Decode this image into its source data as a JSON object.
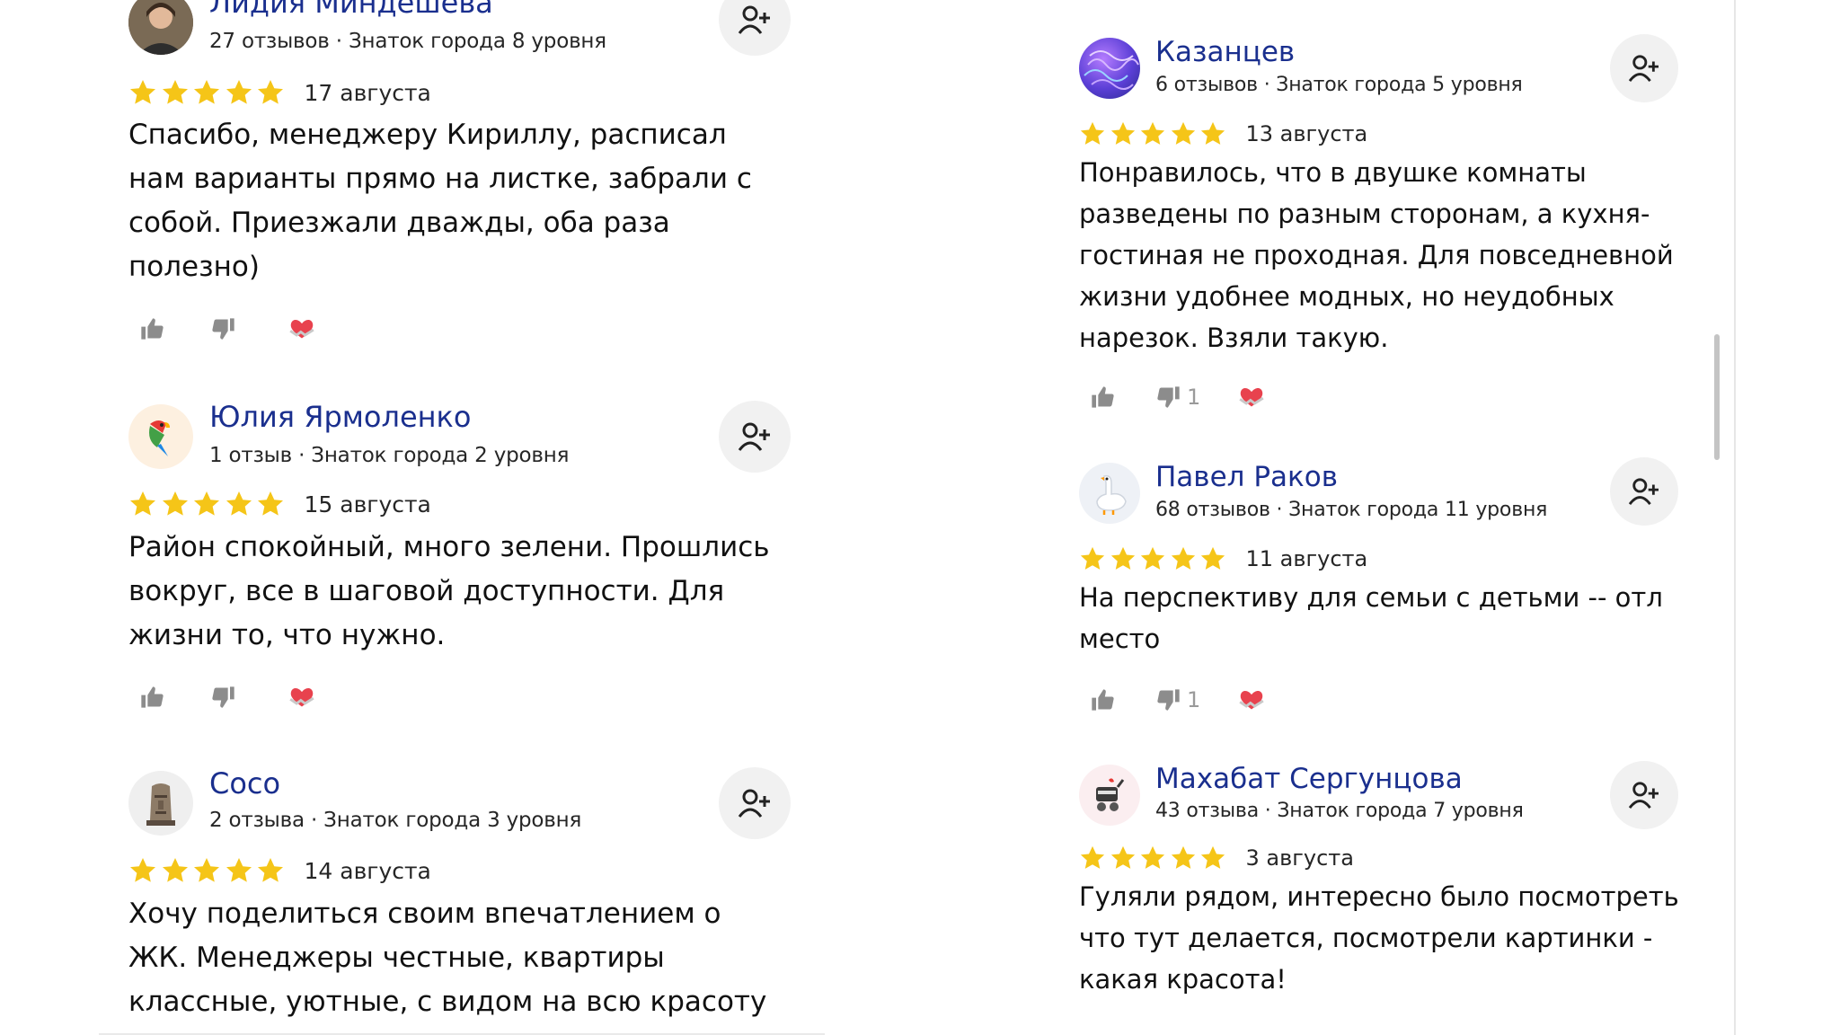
{
  "colors": {
    "author_link": "#1a2f8e",
    "star": "#f5c518",
    "action_gray": "#8c8c8c",
    "subscribe_bg": "#f1f1f1"
  },
  "left_column": {
    "reviews": [
      {
        "author": "Лидия Миндешева",
        "meta": "27 отзывов · Знаток города 8 уровня",
        "rating": 5,
        "date": "17 августа",
        "text": "Спасибо, менеджеру Кириллу, расписал\nнам варианты прямо на листке, забрали с\nсобой. Приезжали дважды, оба раза\nполезно)",
        "avatar_icon": "person-photo-avatar"
      },
      {
        "author": "Юлия Ярмоленко",
        "meta": "1 отзыв · Знаток города 2 уровня",
        "rating": 5,
        "date": "15 августа",
        "text": "Район спокойный, много зелени. Прошлись\nвокруг, все в шаговой доступности. Для\nжизни то, что нужно.",
        "avatar_icon": "parrot-avatar"
      },
      {
        "author": "Coco",
        "meta": "2 отзыва · Знаток города 3 уровня",
        "rating": 5,
        "date": "14 августа",
        "text": "Хочу поделиться своим впечатлением о\nЖК. Менеджеры честные, квартиры\nклассные, уютные, с видом на всю красоту",
        "avatar_icon": "moai-avatar"
      }
    ]
  },
  "right_column": {
    "reviews": [
      {
        "author": "Казанцев",
        "meta": "6 отзывов · Знаток города 5 уровня",
        "rating": 5,
        "date": "13 августа",
        "text": "Понравилось, что в двушке комнаты\nразведены по разным сторонам, а кухня-\nгостиная не проходная. Для повседневной\nжизни удобнее модных, но неудобных\nнарезок. Взяли такую.",
        "dislike_count": "1",
        "avatar_icon": "purple-pattern-avatar"
      },
      {
        "author": "Павел Раков",
        "meta": "68 отзывов · Знаток города 11 уровня",
        "rating": 5,
        "date": "11 августа",
        "text": "На перспективу для семьи с детьми -- отл\nместо",
        "dislike_count": "1",
        "avatar_icon": "goose-avatar"
      },
      {
        "author": "Махабат Сергунцова",
        "meta": "43 отзыва · Знаток города 7 уровня",
        "rating": 5,
        "date": "3 августа",
        "text": "Гуляли рядом, интересно было посмотреть\nчто тут делается, посмотрели картинки -\nкакая красота!",
        "avatar_icon": "stroller-avatar"
      }
    ]
  }
}
